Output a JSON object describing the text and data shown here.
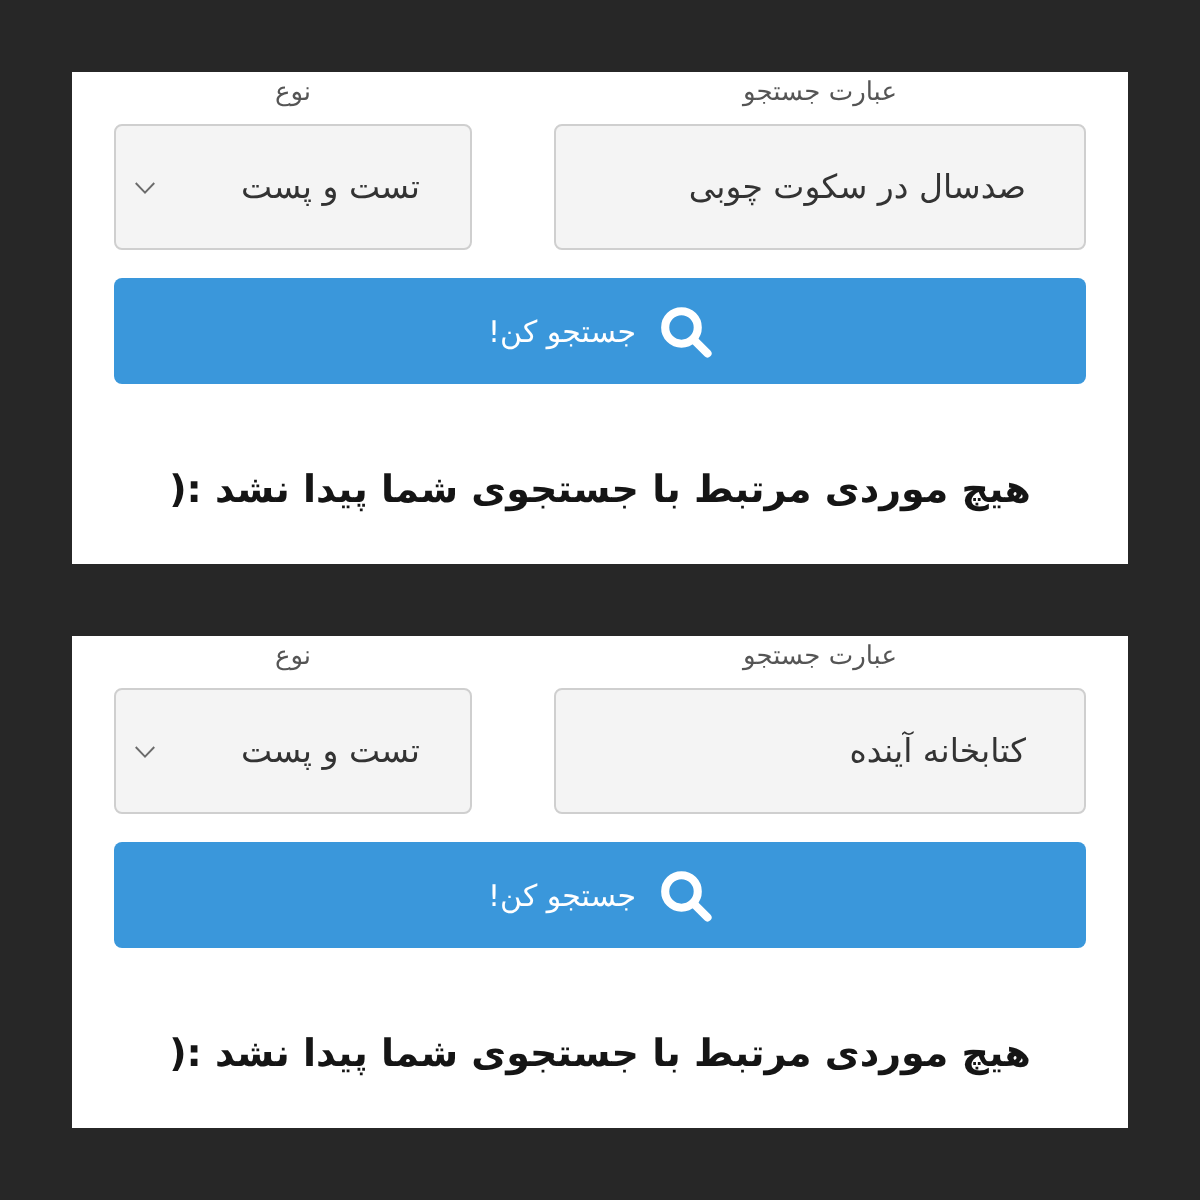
{
  "panels": [
    {
      "query": {
        "label": "عبارت جستجو",
        "value": "صدسال در سکوت چوبی"
      },
      "type": {
        "label": "نوع",
        "value": "تست و پست"
      },
      "button": {
        "label": "جستجو کن!"
      },
      "message": "هیچ موردی مرتبط با جستجوی شما پیدا نشد :("
    },
    {
      "query": {
        "label": "عبارت جستجو",
        "value": "کتابخانه آینده"
      },
      "type": {
        "label": "نوع",
        "value": "تست و پست"
      },
      "button": {
        "label": "جستجو کن!"
      },
      "message": "هیچ موردی مرتبط با جستجوی شما پیدا نشد :("
    }
  ]
}
